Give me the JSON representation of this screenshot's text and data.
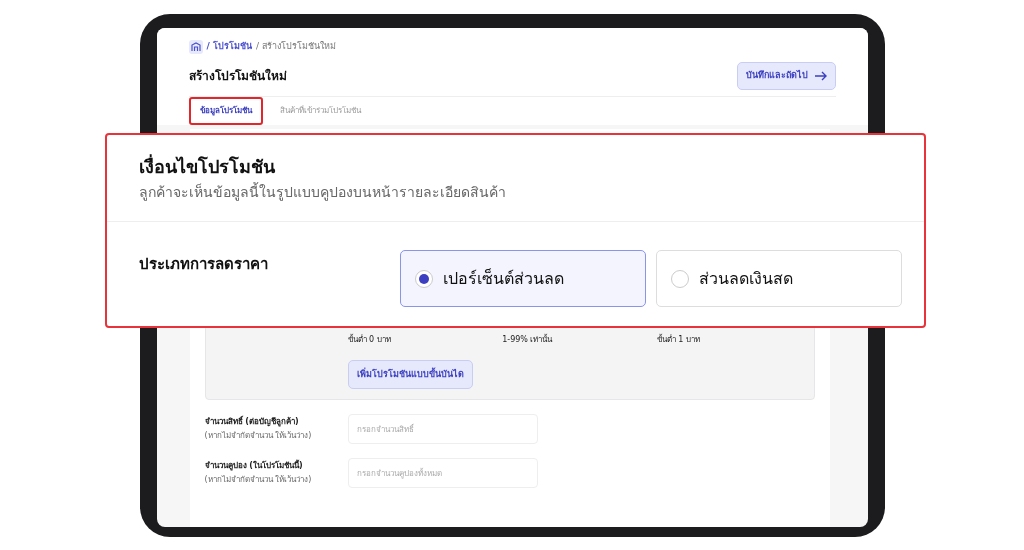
{
  "breadcrumb": [
    {
      "label": "/ โปรโมชัน",
      "kind": "link"
    },
    {
      "label": "/ สร้างโปรโมชันใหม่",
      "kind": "current"
    }
  ],
  "page_title": "สร้างโปรโมชันใหม่",
  "save_button": "บันทึกและถัดไป",
  "tabs": [
    {
      "label": "ข้อมูลโปรโมชัน",
      "selected": true
    },
    {
      "label": "สินค้าที่เข้าร่วมโปรโมชัน",
      "selected": false
    }
  ],
  "tier_fields": [
    {
      "hint": "ขั้นต่ำ 0 บาท"
    },
    {
      "hint": "1-99% เท่านั้น"
    },
    {
      "hint": "ขั้นต่ำ 1 บาท"
    }
  ],
  "add_tier_button": "เพิ่มโปรโมชันแบบขั้นบันได",
  "limit_fields": [
    {
      "label": "จำนวนสิทธิ์ (ต่อบัญชีลูกค้า)",
      "note": "(หากไม่จำกัดจำนวน ให้เว้นว่าง)",
      "placeholder": "กรอกจำนวนสิทธิ์"
    },
    {
      "label": "จำนวนคูปอง (ในโปรโมชันนี้)",
      "note": "(หากไม่จำกัดจำนวน ให้เว้นว่าง)",
      "placeholder": "กรอกจำนวนคูปองทั้งหมด"
    }
  ],
  "callout": {
    "title": "เงื่อนไขโปรโมชัน",
    "subtitle": "ลูกค้าจะเห็นข้อมูลนี้ในรูปแบบคูปองบนหน้ารายละเอียดสินค้า",
    "discount_type_label": "ประเภทการลดราคา",
    "options": [
      {
        "label": "เปอร์เซ็นต์ส่วนลด",
        "selected": true
      },
      {
        "label": "ส่วนลดเงินสด",
        "selected": false
      }
    ]
  }
}
